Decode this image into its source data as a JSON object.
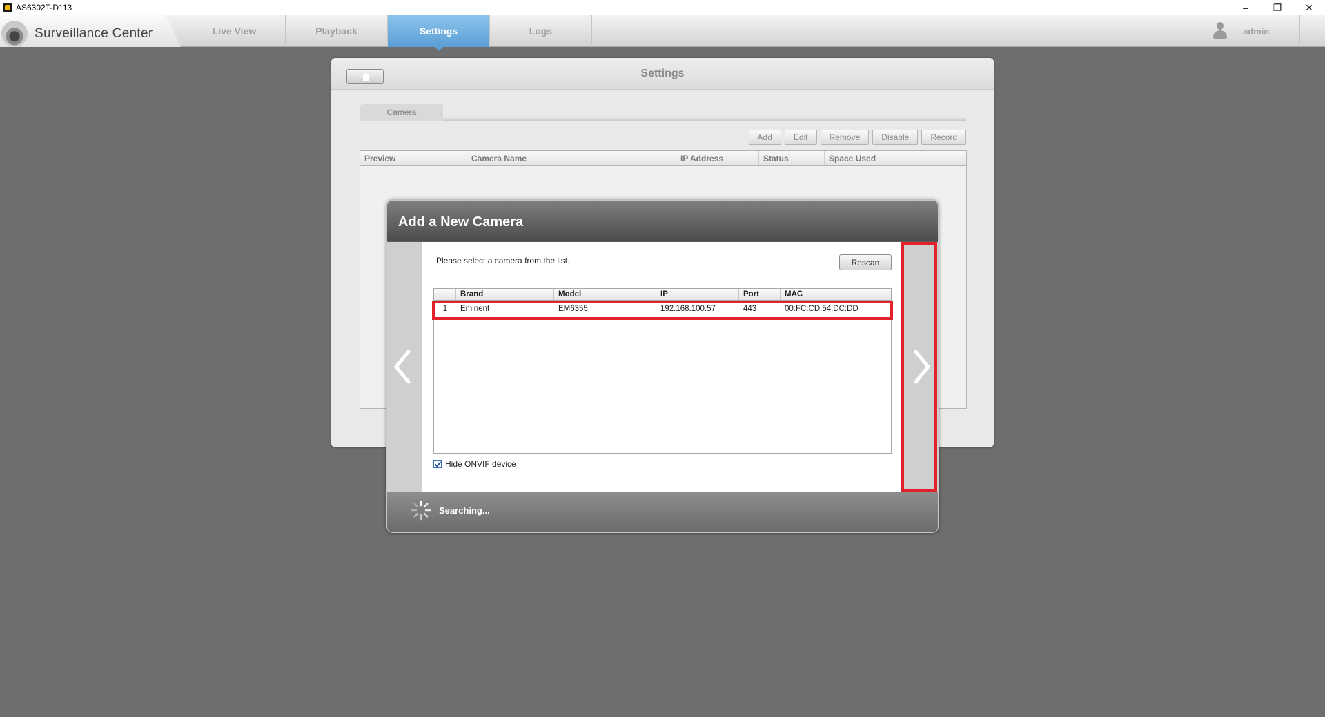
{
  "window": {
    "title": "AS6302T-D113",
    "minimize": "–",
    "restore": "❐",
    "close": "✕"
  },
  "header": {
    "app_name": "Surveillance Center",
    "tabs": [
      {
        "label": "Live View",
        "active": false
      },
      {
        "label": "Playback",
        "active": false
      },
      {
        "label": "Settings",
        "active": true
      },
      {
        "label": "Logs",
        "active": false
      }
    ],
    "user": "admin"
  },
  "settings": {
    "title": "Settings",
    "tab": "Camera",
    "toolbar": [
      "Add",
      "Edit",
      "Remove",
      "Disable",
      "Record"
    ],
    "table_headers": [
      "Preview",
      "Camera Name",
      "IP Address",
      "Status",
      "Space Used"
    ]
  },
  "modal": {
    "title": "Add a New Camera",
    "prompt": "Please select a camera from the list.",
    "rescan_label": "Rescan",
    "columns": [
      "",
      "Brand",
      "Model",
      "IP",
      "Port",
      "MAC"
    ],
    "rows": [
      {
        "num": "1",
        "brand": "Eminent",
        "model": "EM6355",
        "ip": "192.168.100.57",
        "port": "443",
        "mac": "00:FC:CD:54:DC:DD"
      }
    ],
    "hide_onvif_label": "Hide ONVIF device",
    "hide_onvif_checked": true,
    "status": "Searching..."
  },
  "colors": {
    "accent": "#5b9fd6",
    "highlight": "#e3212b"
  }
}
